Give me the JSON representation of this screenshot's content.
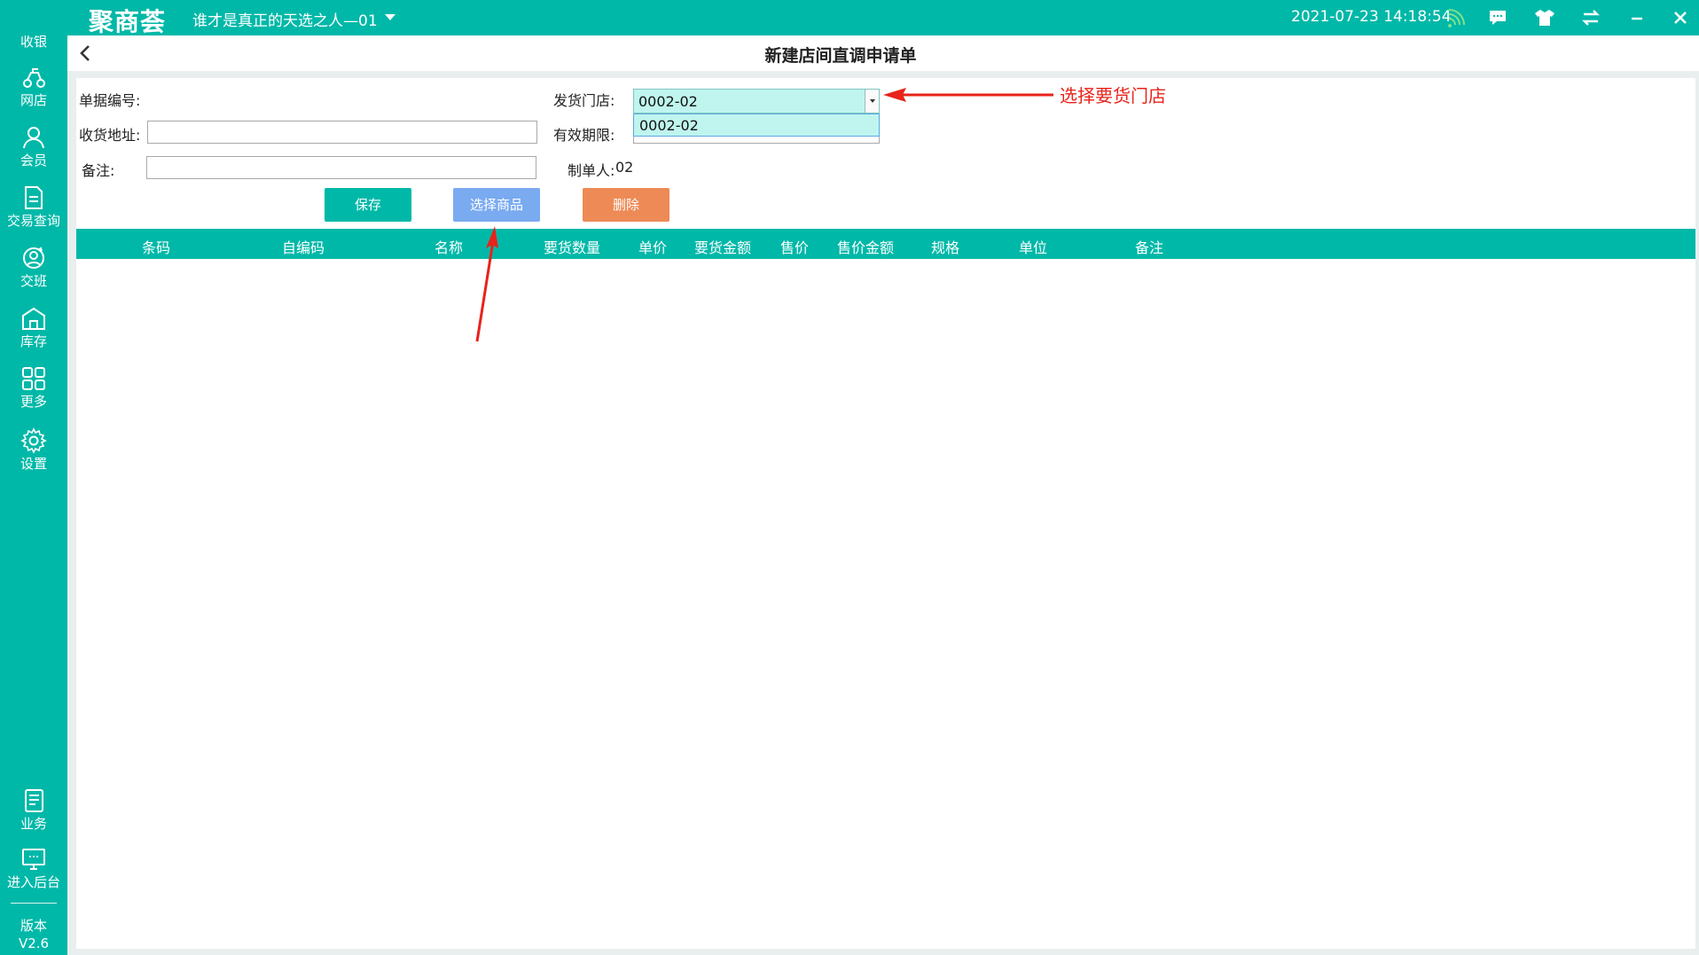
{
  "app": {
    "logo_text": "聚商荟",
    "store_name": "谁才是真正的天选之人—01",
    "datetime": "2021-07-23 14:18:54"
  },
  "topbar_icons": [
    "wifi-icon",
    "message-icon",
    "shirt-icon",
    "swap-icon",
    "minimize-icon",
    "close-icon"
  ],
  "sidebar": {
    "items": [
      {
        "label": "收银",
        "icon": "cashier-icon"
      },
      {
        "label": "网店",
        "icon": "delivery-icon"
      },
      {
        "label": "会员",
        "icon": "member-icon"
      },
      {
        "label": "交易查询",
        "icon": "document-icon"
      },
      {
        "label": "交班",
        "icon": "handover-icon"
      },
      {
        "label": "库存",
        "icon": "warehouse-icon"
      },
      {
        "label": "更多",
        "icon": "grid-icon"
      },
      {
        "label": "设置",
        "icon": "gear-icon"
      }
    ],
    "bottom_items": [
      {
        "label": "业务",
        "icon": "business-icon"
      },
      {
        "label": "进入后台",
        "icon": "monitor-icon"
      }
    ],
    "version_label": "版本",
    "version_value": "V2.6"
  },
  "page": {
    "title": "新建店间直调申请单"
  },
  "form": {
    "doc_no_label": "单据编号:",
    "ship_store_label": "发货门店:",
    "ship_store_value": "0002-02",
    "ship_store_option": "0002-02",
    "address_label": "收货地址:",
    "address_value": "",
    "expiry_label": "有效期限:",
    "remark_label": "备注:",
    "remark_value": "",
    "creator_label": "制单人:",
    "creator_value": "02"
  },
  "buttons": {
    "save": "保存",
    "select_goods": "选择商品",
    "delete": "删除"
  },
  "table": {
    "columns": [
      "条码",
      "自编码",
      "名称",
      "要货数量",
      "单价",
      "要货金额",
      "售价",
      "售价金额",
      "规格",
      "单位",
      "备注"
    ],
    "rows": []
  },
  "annotation": {
    "text": "选择要货门店",
    "color": "#e8231a"
  },
  "colors": {
    "primary": "#00b8a8",
    "select_goods": "#7aaaf0",
    "delete": "#ed8a55",
    "dropdown_bg": "#bff5ee"
  }
}
